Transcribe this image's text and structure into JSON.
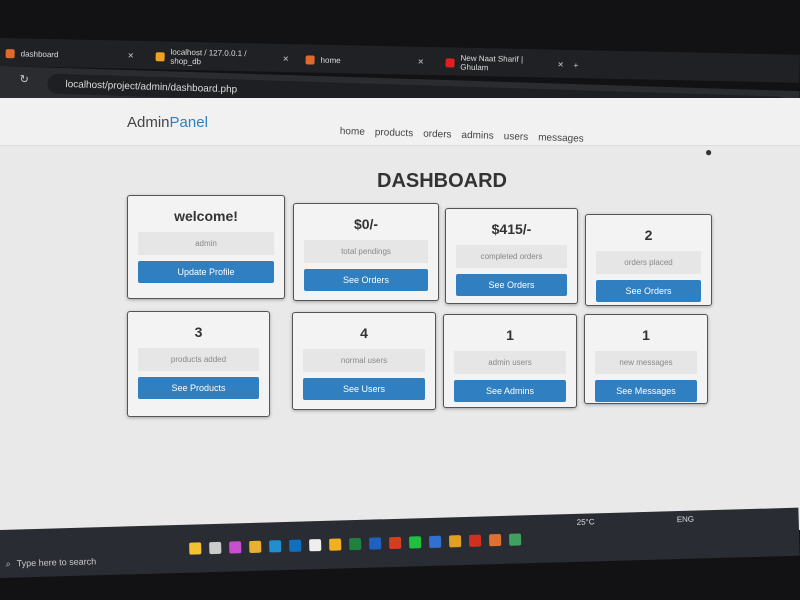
{
  "browser": {
    "tabs": [
      {
        "title": "dashboard",
        "color": "#e06a2b"
      },
      {
        "title": "localhost / 127.0.0.1 / shop_db",
        "color": "#f0a020"
      },
      {
        "title": "home",
        "color": "#e06a2b"
      },
      {
        "title": "New Naat Sharif | Ghulam",
        "color": "#e02020"
      }
    ],
    "url": "localhost/project/admin/dashboard.php"
  },
  "header": {
    "brand_a": "Admin",
    "brand_b": "Panel",
    "menu": [
      "home",
      "products",
      "orders",
      "admins",
      "users",
      "messages"
    ],
    "user_icon": "user-icon"
  },
  "title": "DASHBOARD",
  "cards": [
    {
      "value": "welcome!",
      "label": "admin",
      "button": "Update Profile"
    },
    {
      "value": "$0/-",
      "label": "total pendings",
      "button": "See Orders"
    },
    {
      "value": "$415/-",
      "label": "completed orders",
      "button": "See Orders"
    },
    {
      "value": "2",
      "label": "orders placed",
      "button": "See Orders"
    },
    {
      "value": "3",
      "label": "products added",
      "button": "See Products"
    },
    {
      "value": "4",
      "label": "normal users",
      "button": "See Users"
    },
    {
      "value": "1",
      "label": "admin users",
      "button": "See Admins"
    },
    {
      "value": "1",
      "label": "new messages",
      "button": "See Messages"
    }
  ],
  "taskbar": {
    "search_placeholder": "Type here to search",
    "weather": "25°C",
    "language": "ENG"
  },
  "accent": "#2f7fc1"
}
